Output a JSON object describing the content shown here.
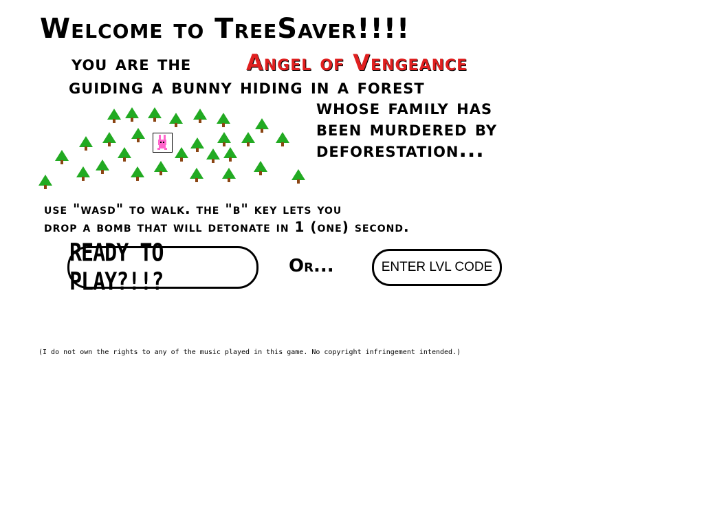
{
  "title": "Welcome to TreeSaver!!!!",
  "story": {
    "line1": "You are the",
    "angel": "Angel of Vengeance",
    "line2": "guiding a bunny hiding in a forest",
    "line3": "whose family has",
    "line4": "been murdered by",
    "line5": "deforestation..."
  },
  "instructions": {
    "line1": "Use \"WASD\" to walk. The \"B\" key lets you",
    "line2": "Drop a bomb that will detonate in 1 (one) second."
  },
  "buttons": {
    "ready": "READY TO PLAY?!!?",
    "or": "Or...",
    "level_code": "ENTER LVL CODE"
  },
  "disclaimer": "(I do not own the rights to any of the music played in this game. No copyright infringement intended.)",
  "colors": {
    "angel_text": "#e02020",
    "tree": "#22aa22",
    "trunk": "#8b4513",
    "bunny": "#ff66cc"
  },
  "icons": [
    "tree-icon",
    "bunny-icon"
  ]
}
